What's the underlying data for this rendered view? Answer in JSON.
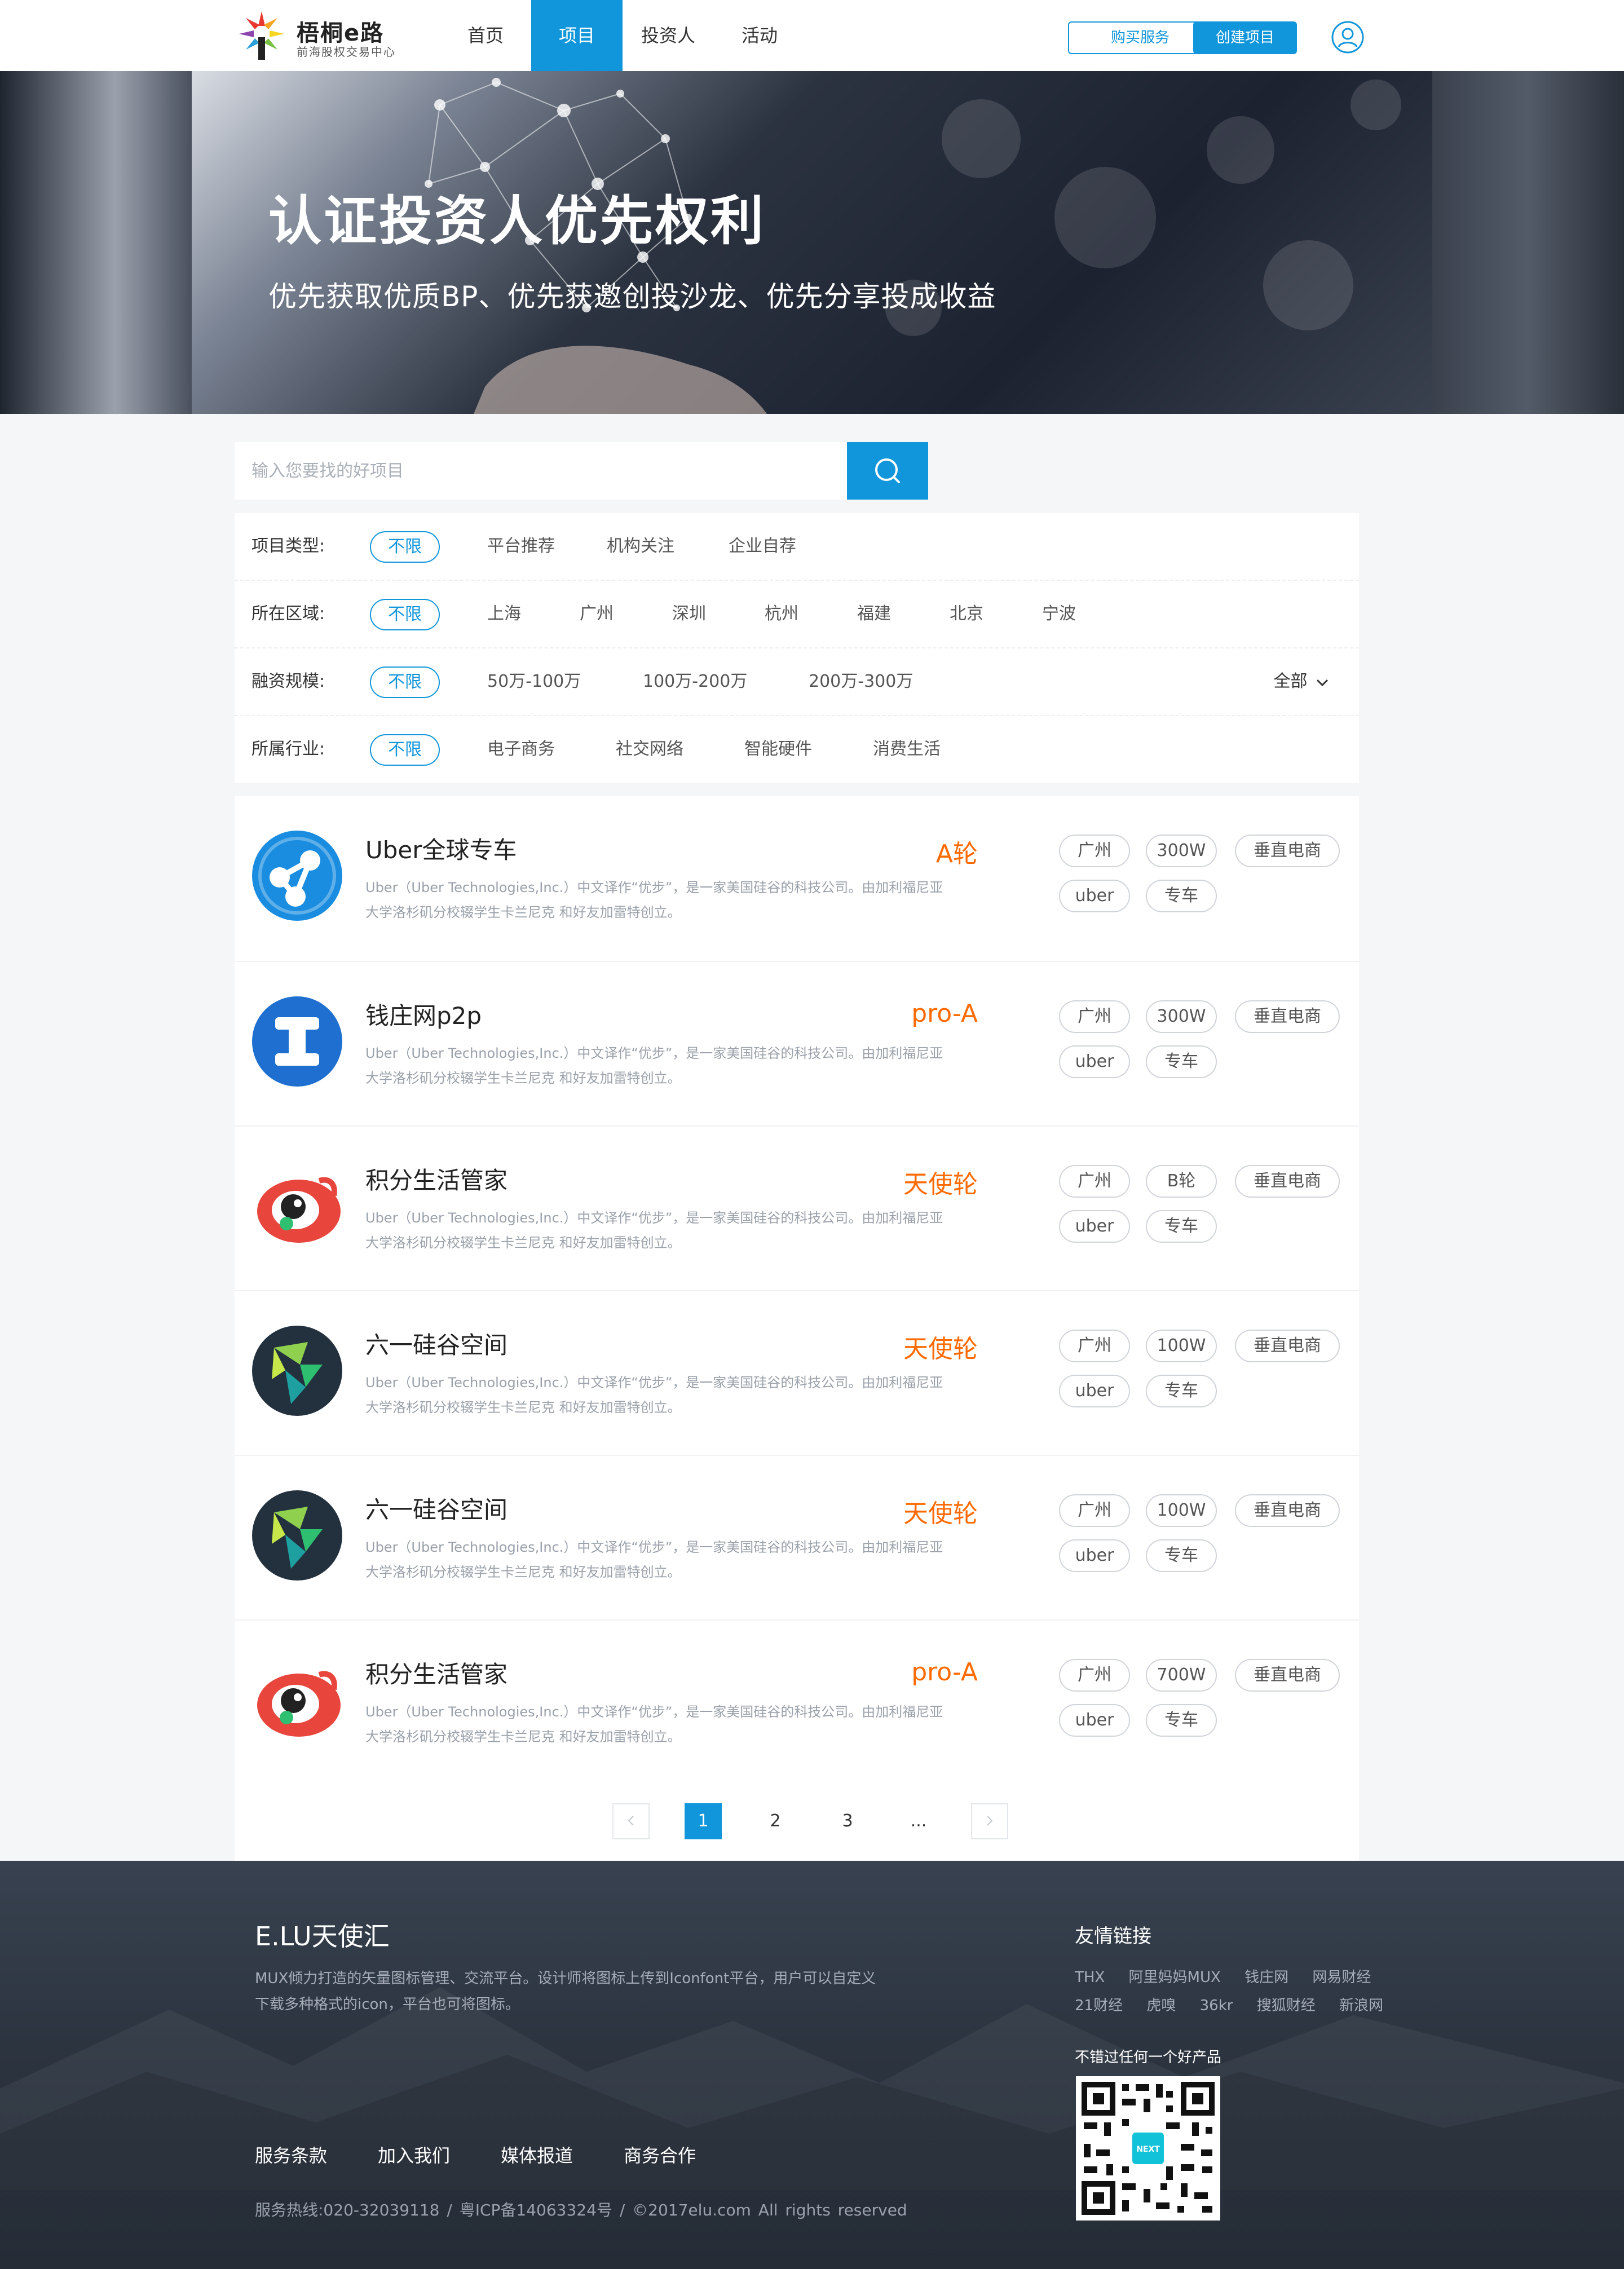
{
  "header": {
    "logo_title": "梧桐e路",
    "logo_sub": "前海股权交易中心",
    "nav": [
      {
        "label": "首页"
      },
      {
        "label": "项目"
      },
      {
        "label": "投资人"
      },
      {
        "label": "活动"
      }
    ],
    "buy_label": "购买服务",
    "create_label": "创建项目"
  },
  "banner": {
    "title": "认证投资人优先权利",
    "subtitle": "优先获取优质BP、优先获邀创投沙龙、优先分享投成收益"
  },
  "search": {
    "placeholder": "输入您要找的好项目"
  },
  "filters": [
    {
      "label": "项目类型:",
      "active": "不限",
      "options": [
        "平台推荐",
        "机构关注",
        "企业自荐"
      ]
    },
    {
      "label": "所在区域:",
      "active": "不限",
      "options": [
        "上海",
        "广州",
        "深圳",
        "杭州",
        "福建",
        "北京",
        "宁波"
      ]
    },
    {
      "label": "融资规模:",
      "active": "不限",
      "options": [
        "50万-100万",
        "100万-200万",
        "200万-300万"
      ],
      "more": "全部"
    },
    {
      "label": "所属行业:",
      "active": "不限",
      "options": [
        "电子商务",
        "社交网络",
        "智能硬件",
        "消费生活"
      ]
    }
  ],
  "projects": [
    {
      "name": "Uber全球专车",
      "stage": "A轮",
      "desc1": "Uber（Uber Technologies,Inc.）中文译作“优步”，是一家美国硅谷的科技公司。由加利福尼亚",
      "desc2": "大学洛杉矶分校辍学生卡兰尼克 和好友加雷特创立。",
      "tags": [
        "广州",
        "300W",
        "垂直电商",
        "uber",
        "专车"
      ],
      "icon": "uber-share-icon"
    },
    {
      "name": "钱庄网p2p",
      "stage": "pro-A",
      "desc1": "Uber（Uber Technologies,Inc.）中文译作“优步”，是一家美国硅谷的科技公司。由加利福尼亚",
      "desc2": "大学洛杉矶分校辍学生卡兰尼克 和好友加雷特创立。",
      "tags": [
        "广州",
        "300W",
        "垂直电商",
        "uber",
        "专车"
      ],
      "icon": "qianzhuang-i-icon"
    },
    {
      "name": "积分生活管家",
      "stage": "天使轮",
      "desc1": "Uber（Uber Technologies,Inc.）中文译作“优步”，是一家美国硅谷的科技公司。由加利福尼亚",
      "desc2": "大学洛杉矶分校辍学生卡兰尼克 和好友加雷特创立。",
      "tags": [
        "广州",
        "B轮",
        "垂直电商",
        "uber",
        "专车"
      ],
      "icon": "weibo-eye-icon"
    },
    {
      "name": "六一硅谷空间",
      "stage": "天使轮",
      "desc1": "Uber（Uber Technologies,Inc.）中文译作“优步”，是一家美国硅谷的科技公司。由加利福尼亚",
      "desc2": "大学洛杉矶分校辍学生卡兰尼克 和好友加雷特创立。",
      "tags": [
        "广州",
        "100W",
        "垂直电商",
        "uber",
        "专车"
      ],
      "icon": "liuyi-logo-icon"
    },
    {
      "name": "六一硅谷空间",
      "stage": "天使轮",
      "desc1": "Uber（Uber Technologies,Inc.）中文译作“优步”，是一家美国硅谷的科技公司。由加利福尼亚",
      "desc2": "大学洛杉矶分校辍学生卡兰尼克 和好友加雷特创立。",
      "tags": [
        "广州",
        "100W",
        "垂直电商",
        "uber",
        "专车"
      ],
      "icon": "liuyi-logo-icon"
    },
    {
      "name": "积分生活管家",
      "stage": "pro-A",
      "desc1": "Uber（Uber Technologies,Inc.）中文译作“优步”，是一家美国硅谷的科技公司。由加利福尼亚",
      "desc2": "大学洛杉矶分校辍学生卡兰尼克 和好友加雷特创立。",
      "tags": [
        "广州",
        "700W",
        "垂直电商",
        "uber",
        "专车"
      ],
      "icon": "weibo-eye-icon"
    }
  ],
  "pagination": {
    "pages": [
      "1",
      "2",
      "3",
      "..."
    ],
    "current": "1"
  },
  "footer": {
    "brand": "E.LU天使汇",
    "desc1": "MUX倾力打造的矢量图标管理、交流平台。设计师将图标上传到Iconfont平台，用户可以自定义",
    "desc2": "下载多种格式的icon，平台也可将图标。",
    "links": [
      "服务条款",
      "加入我们",
      "媒体报道",
      "商务合作"
    ],
    "copyright": "服务热线:020-32039118  /   粤ICP备14063324号  /   ©2017elu.com All rights reserved",
    "friend_title": "友情链接",
    "friends_row1": [
      "THX",
      "阿里妈妈MUX",
      "钱庄网",
      "网易财经"
    ],
    "friends_row2": [
      "21财经",
      "虎嗅",
      "36kr",
      "搜狐财经",
      "新浪网"
    ],
    "qr_label": "不错过任何一个好产品",
    "qr_badge": "NEXT"
  },
  "colors": {
    "accent": "#1296db",
    "stage": "#ff6a00",
    "footer_bg": "#2c3440"
  }
}
